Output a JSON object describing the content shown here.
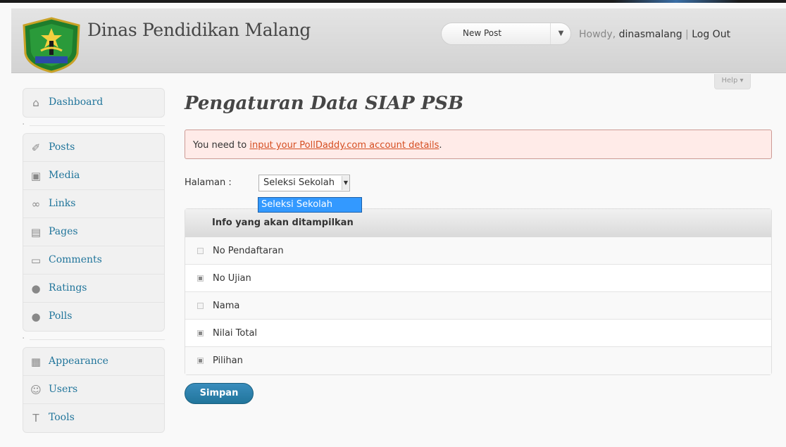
{
  "header": {
    "site_title": "Dinas Pendidikan Malang",
    "favorite_action": "New Post",
    "favorite_toggle": "▼",
    "howdy": "Howdy,",
    "username": "dinasmalang",
    "separator": "|",
    "logout": "Log Out"
  },
  "help": {
    "label": "Help ▾"
  },
  "sidebar": {
    "groups": [
      [
        {
          "label": "Dashboard",
          "icon": "home-icon"
        }
      ],
      [
        {
          "label": "Posts",
          "icon": "pushpin-icon"
        },
        {
          "label": "Media",
          "icon": "media-icon"
        },
        {
          "label": "Links",
          "icon": "link-icon"
        },
        {
          "label": "Pages",
          "icon": "pages-icon"
        },
        {
          "label": "Comments",
          "icon": "comment-icon"
        },
        {
          "label": "Ratings",
          "icon": "circle-icon"
        },
        {
          "label": "Polls",
          "icon": "circle-icon"
        }
      ],
      [
        {
          "label": "Appearance",
          "icon": "appearance-icon"
        },
        {
          "label": "Users",
          "icon": "users-icon"
        },
        {
          "label": "Tools",
          "icon": "tools-icon"
        }
      ]
    ]
  },
  "main": {
    "title": "Pengaturan Data SIAP PSB",
    "notice": {
      "before": "You need to ",
      "link": "input your PollDaddy.com account details",
      "after": "."
    },
    "halaman_label": "Halaman :",
    "select_value": "Seleksi Sekolah",
    "dropdown_option": "Seleksi Sekolah",
    "table_header": "Info yang akan ditampilkan",
    "rows": [
      {
        "label": "No Pendaftaran",
        "checked": false
      },
      {
        "label": "No Ujian",
        "checked": true
      },
      {
        "label": "Nama",
        "checked": false
      },
      {
        "label": "Nilai Total",
        "checked": true
      },
      {
        "label": "Pilihan",
        "checked": true
      }
    ],
    "submit_label": "Simpan"
  },
  "colors": {
    "link": "#21759b",
    "notice_bg": "#ffebe8",
    "notice_link": "#d54e21",
    "button": "#21759b",
    "dropdown_highlight": "#3399ff"
  }
}
